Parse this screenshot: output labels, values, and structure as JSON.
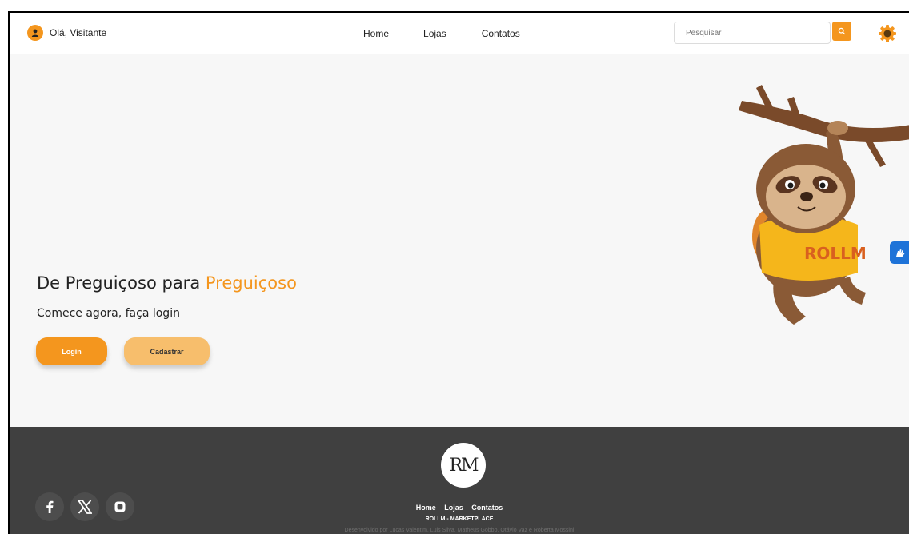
{
  "header": {
    "greeting": "Olá, Visitante",
    "nav": [
      "Home",
      "Lojas",
      "Contatos"
    ],
    "search_placeholder": "Pesquisar",
    "icons": {
      "user": "user-icon",
      "search": "search-icon",
      "settings": "gear-icon"
    }
  },
  "hero": {
    "title_prefix": "De Preguiçoso para ",
    "title_accent": "Preguiçoso",
    "subtitle": "Comece agora, faça login",
    "login_label": "Login",
    "register_label": "Cadastrar",
    "mascot_shirt_text": "ROLLM"
  },
  "footer": {
    "logo_letters": "RM",
    "nav": [
      "Home",
      "Lojas",
      "Contatos"
    ],
    "brand": "ROLLM - MARKETPLACE",
    "credits": "Desenvolvido por Lucas Valentim, Luis Silva, Matheus Gobbo, Otávio Vaz e Roberta Mossini",
    "socials": [
      "facebook-icon",
      "x-icon",
      "instagram-icon"
    ]
  },
  "accessibility": {
    "icon": "sign-language-icon"
  },
  "colors": {
    "accent": "#f4961e",
    "accent_light": "#f7be6c",
    "footer_bg": "#404040",
    "accessibility_blue": "#1e73d8"
  }
}
